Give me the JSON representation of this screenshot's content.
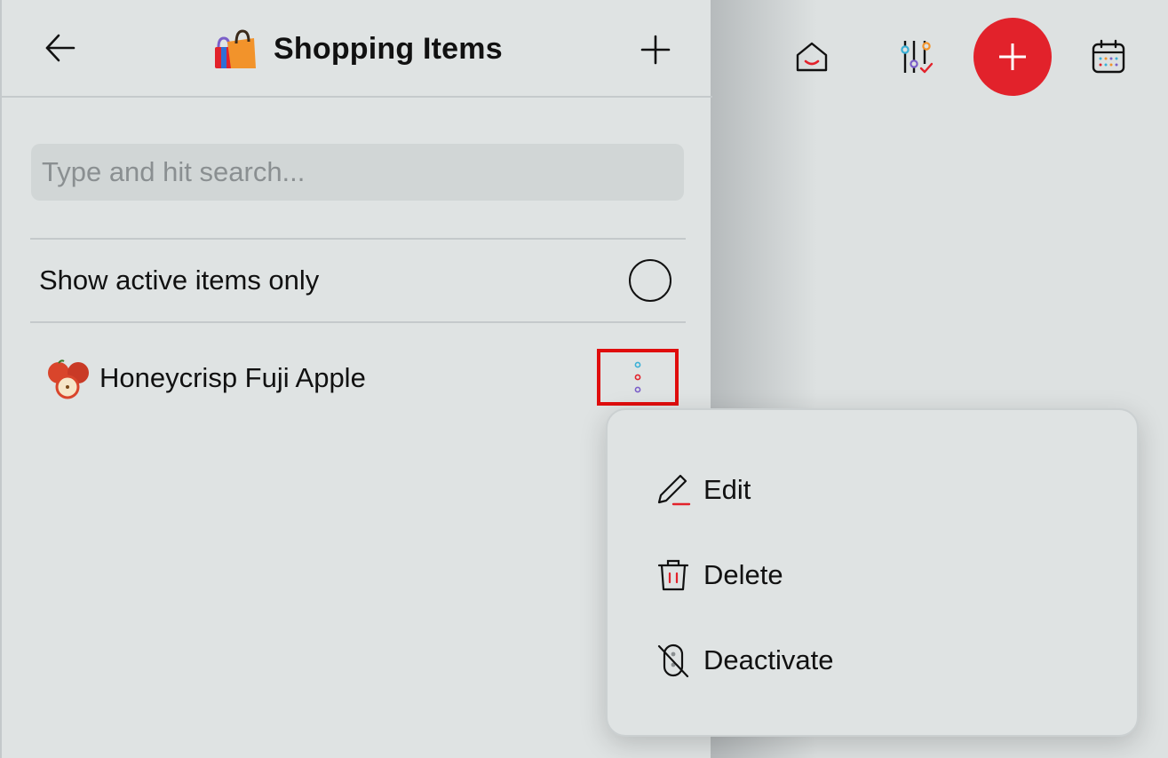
{
  "header": {
    "title": "Shopping Items",
    "emoji_icon": "shopping-bags-icon",
    "back_icon": "arrow-left-icon",
    "add_icon": "plus-icon"
  },
  "search": {
    "placeholder": "Type and hit search...",
    "value": ""
  },
  "filter": {
    "label": "Show active items only",
    "checked": false
  },
  "items": [
    {
      "label": "Honeycrisp Fuji Apple",
      "emoji_icon": "apple-icon"
    }
  ],
  "context_menu": {
    "items": [
      {
        "label": "Edit",
        "icon": "pencil-icon"
      },
      {
        "label": "Delete",
        "icon": "trash-icon"
      },
      {
        "label": "Deactivate",
        "icon": "deactivate-icon"
      }
    ]
  },
  "toolbar": {
    "home_icon": "home-icon",
    "filters_icon": "sliders-icon",
    "add_icon": "plus-icon",
    "calendar_icon": "calendar-icon"
  },
  "colors": {
    "accent": "#e2222b",
    "background": "#dfe3e3",
    "highlight_border": "#e00d0d"
  }
}
